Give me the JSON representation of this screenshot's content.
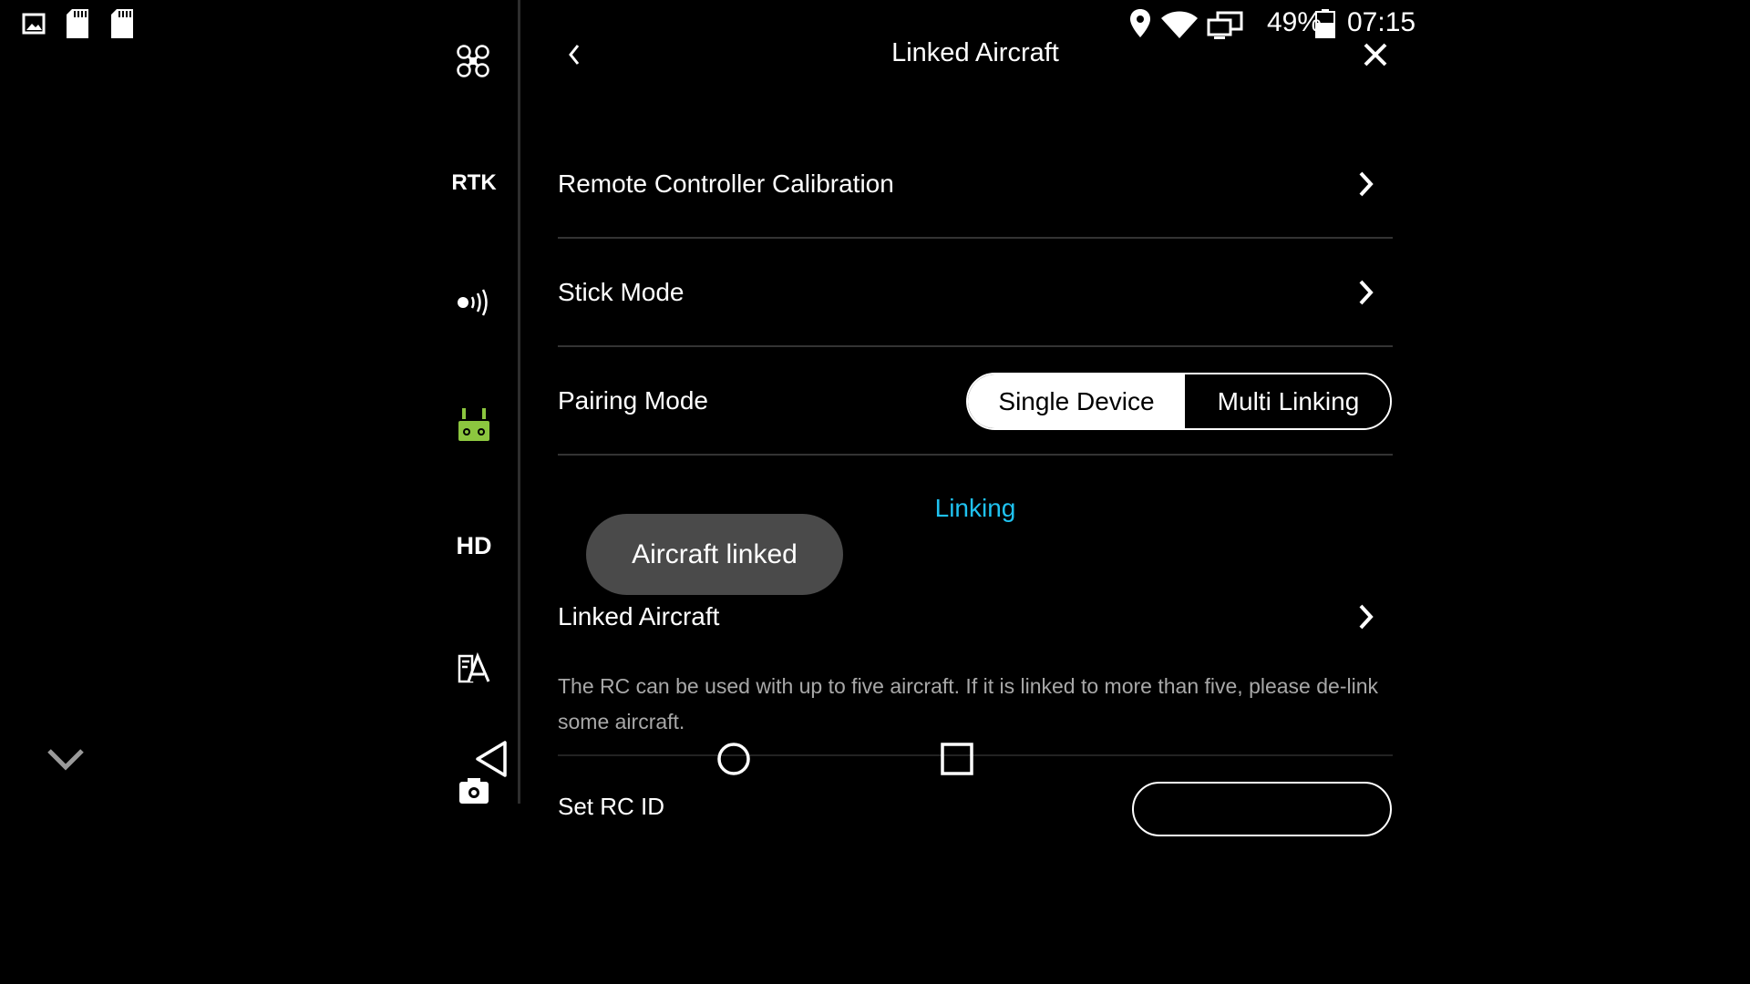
{
  "status_bar": {
    "battery_percent": "49%",
    "time": "07:15",
    "left_icons": [
      "gallery-icon",
      "sd-card-icon",
      "sd-card-icon"
    ],
    "right_icons": [
      "location-icon",
      "wifi-icon",
      "cast-screen-icon",
      "battery-icon"
    ]
  },
  "side_rail": {
    "items": [
      {
        "icon": "aircraft-icon",
        "label": ""
      },
      {
        "icon": "rtk-icon",
        "label": "RTK"
      },
      {
        "icon": "signal-icon",
        "label": ""
      },
      {
        "icon": "remote-controller-icon",
        "label": "",
        "active": true
      },
      {
        "icon": "hd-icon",
        "label": "HD"
      },
      {
        "icon": "general-settings-icon",
        "label": ""
      },
      {
        "icon": "camera-icon",
        "label": ""
      }
    ],
    "active_color": "#8cc63f"
  },
  "header": {
    "title": "Linked Aircraft"
  },
  "settings": {
    "rc_calibration_label": "Remote Controller Calibration",
    "stick_mode_label": "Stick Mode",
    "pairing_mode_label": "Pairing Mode",
    "pairing_options": [
      "Single Device",
      "Multi Linking"
    ],
    "pairing_selected": "Single Device",
    "linking_status": "Linking",
    "linked_aircraft_label": "Linked Aircraft",
    "linked_description": "The RC can be used with up to five aircraft. If it is linked to more than five, please de-link some aircraft.",
    "partially_visible_label": "Set RC ID"
  },
  "toast": {
    "message": "Aircraft linked"
  },
  "nav_bar": {
    "buttons": [
      "back-icon",
      "home-icon",
      "recents-icon"
    ]
  },
  "colors": {
    "accent_link": "#1fc2f0",
    "active_green": "#8cc63f",
    "toast_bg": "#4a4a4a"
  }
}
